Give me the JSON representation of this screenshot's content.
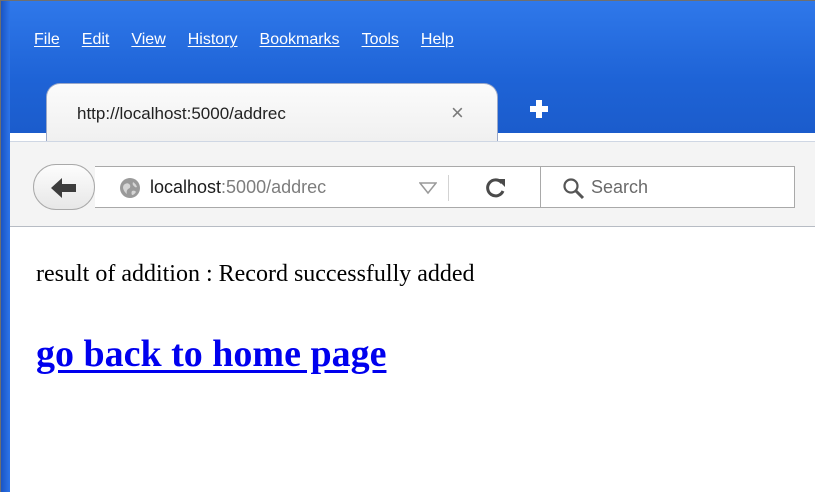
{
  "menu": {
    "items": [
      {
        "label": "File",
        "name": "menu-file"
      },
      {
        "label": "Edit",
        "name": "menu-edit"
      },
      {
        "label": "View",
        "name": "menu-view"
      },
      {
        "label": "History",
        "name": "menu-history"
      },
      {
        "label": "Bookmarks",
        "name": "menu-bookmarks"
      },
      {
        "label": "Tools",
        "name": "menu-tools"
      },
      {
        "label": "Help",
        "name": "menu-help"
      }
    ]
  },
  "tab": {
    "title": "http://localhost:5000/addrec",
    "close_icon": "×"
  },
  "urlbar": {
    "host": "localhost",
    "path": ":5000/addrec"
  },
  "search": {
    "placeholder": "Search"
  },
  "page": {
    "result_text": "result of addition : Record successfully added",
    "home_link": "go back to home page"
  },
  "colors": {
    "chrome_blue": "#1e63d6",
    "link": "#0000ee"
  },
  "icons": {
    "back": "back-arrow-icon",
    "globe": "globe-icon",
    "dropdown": "dropdown-triangle-icon",
    "reload": "reload-icon",
    "search": "search-icon",
    "new_tab": "plus-icon",
    "close_tab": "close-icon"
  }
}
